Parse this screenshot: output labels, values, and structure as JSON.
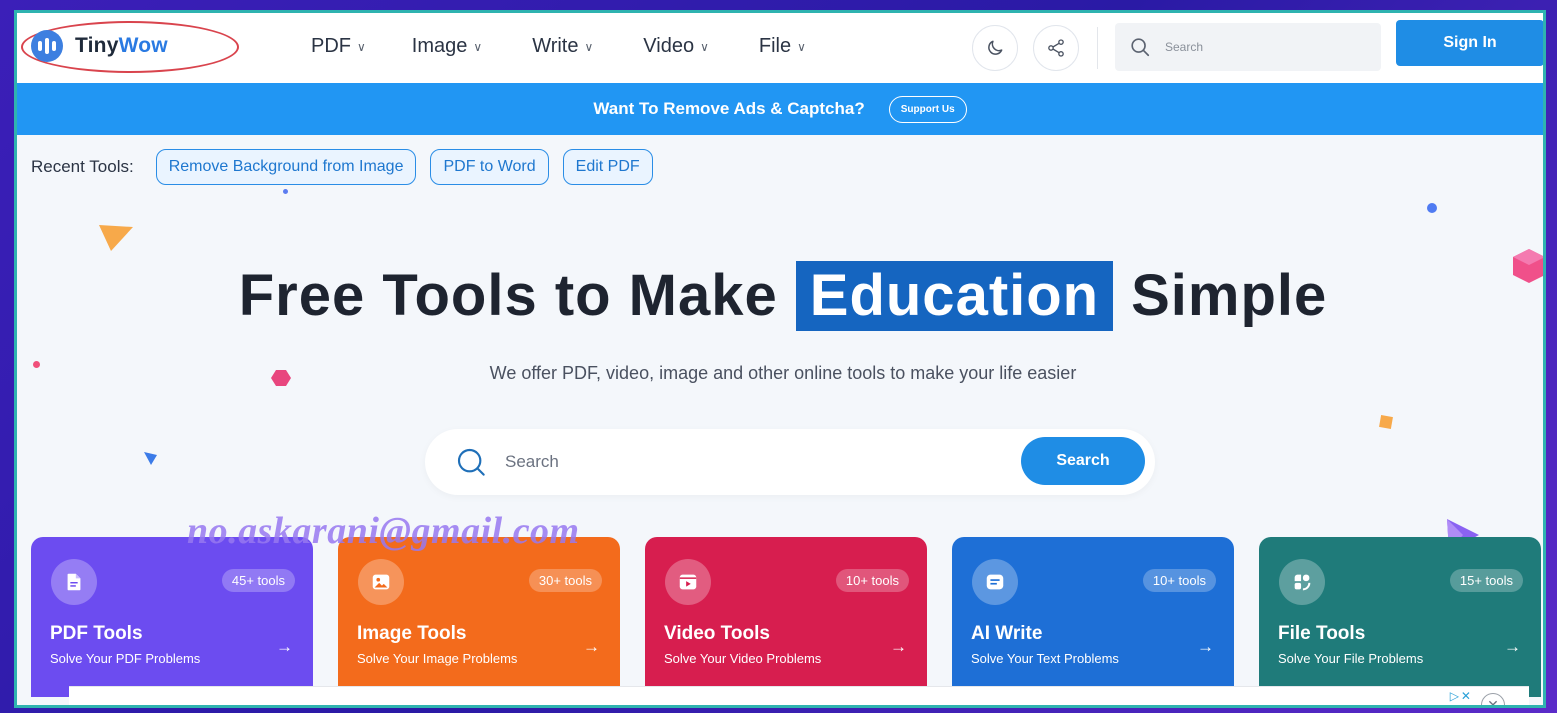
{
  "header": {
    "logo_prefix": "Tiny",
    "logo_suffix": "Wow",
    "nav": [
      {
        "label": "PDF"
      },
      {
        "label": "Image"
      },
      {
        "label": "Write"
      },
      {
        "label": "Video"
      },
      {
        "label": "File"
      }
    ],
    "search_placeholder": "Search",
    "signin_label": "Sign In"
  },
  "banner": {
    "message": "Want To Remove Ads & Captcha?",
    "support_label": "Support Us"
  },
  "recent": {
    "label": "Recent Tools:",
    "items": [
      "Remove Background from Image",
      "PDF to Word",
      "Edit PDF"
    ]
  },
  "hero": {
    "title_before": "Free Tools to Make",
    "title_highlight": "Education",
    "title_after": "Simple",
    "subtitle": "We offer PDF, video, image and other online tools to make your life easier",
    "search_placeholder": "Search",
    "search_button": "Search"
  },
  "watermark": "no.askarani@gmail.com",
  "cards": [
    {
      "title": "PDF Tools",
      "subtitle": "Solve Your PDF Problems",
      "count": "45+ tools",
      "color": "#6c4cf0",
      "icon": "pdf-file-icon"
    },
    {
      "title": "Image Tools",
      "subtitle": "Solve Your Image Problems",
      "count": "30+ tools",
      "color": "#f36b1c",
      "icon": "image-icon"
    },
    {
      "title": "Video Tools",
      "subtitle": "Solve Your Video Problems",
      "count": "10+ tools",
      "color": "#d71e4f",
      "icon": "video-icon"
    },
    {
      "title": "AI Write",
      "subtitle": "Solve Your Text Problems",
      "count": "10+ tools",
      "color": "#1e6fd6",
      "icon": "text-icon"
    },
    {
      "title": "File Tools",
      "subtitle": "Solve Your File Problems",
      "count": "15+ tools",
      "color": "#1f7b7a",
      "icon": "file-shapes-icon"
    }
  ],
  "colors": {
    "accent": "#1f8de5",
    "banner": "#2196f3",
    "highlight": "#1565c0"
  }
}
